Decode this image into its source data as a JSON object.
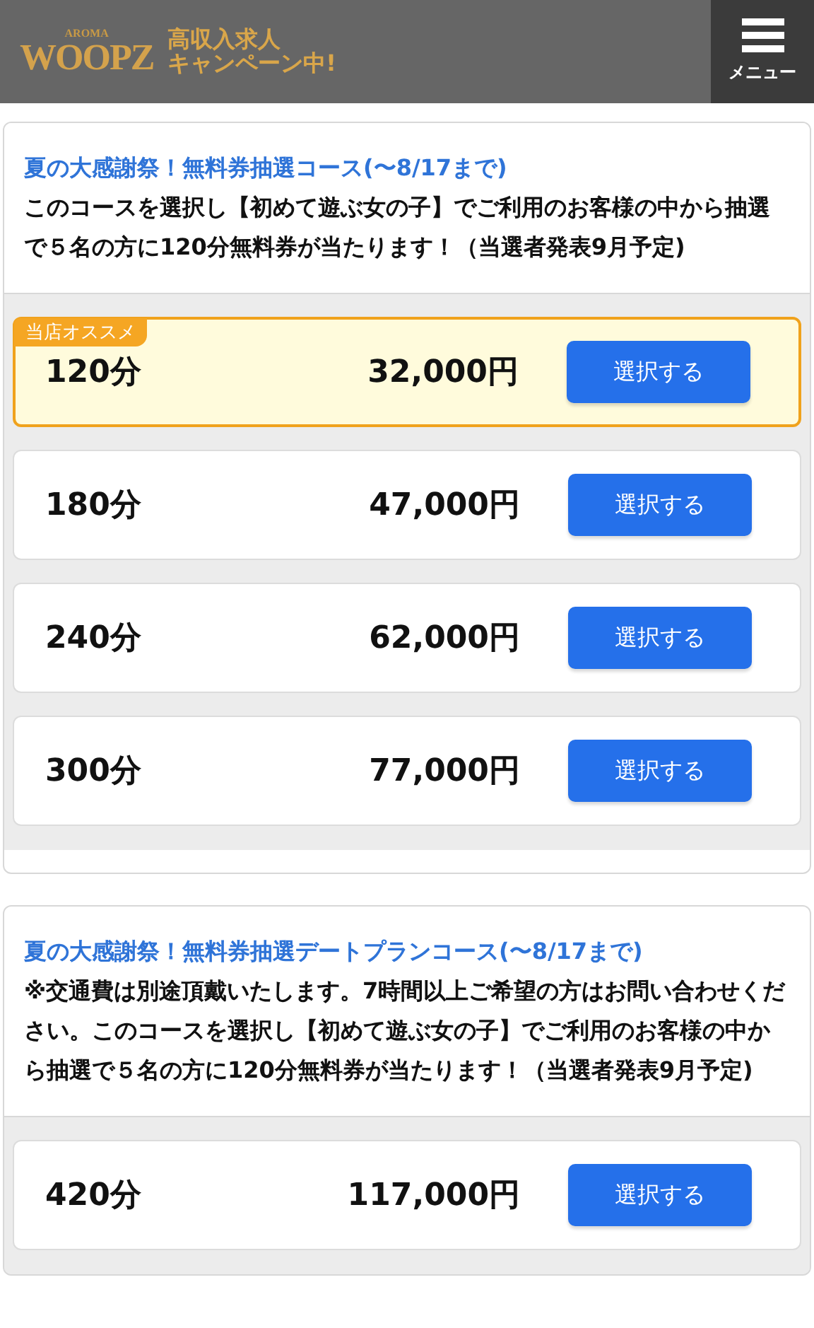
{
  "header": {
    "logo_top": "AROMA",
    "logo_main": "WOOPZ",
    "banner_lines": [
      "高収入求人",
      "キャンペーン中!"
    ],
    "menu_label": "メニュー"
  },
  "sections": [
    {
      "title": "夏の大感謝祭！無料券抽選コース(〜8/17まで)",
      "description": "このコースを選択し【初めて遊ぶ女の子】でご利用のお客様の中から抽選で５名の方に120分無料券が当たります！（当選者発表9月予定)",
      "plans": [
        {
          "duration": "120分",
          "price": "32,000円",
          "button": "選択する",
          "recommended": true,
          "badge": "当店オススメ"
        },
        {
          "duration": "180分",
          "price": "47,000円",
          "button": "選択する",
          "recommended": false
        },
        {
          "duration": "240分",
          "price": "62,000円",
          "button": "選択する",
          "recommended": false
        },
        {
          "duration": "300分",
          "price": "77,000円",
          "button": "選択する",
          "recommended": false
        }
      ]
    },
    {
      "title": "夏の大感謝祭！無料券抽選デートプランコース(〜8/17まで)",
      "description": "※交通費は別途頂戴いたします。7時間以上ご希望の方はお問い合わせください。このコースを選択し【初めて遊ぶ女の子】でご利用のお客様の中から抽選で５名の方に120分無料券が当たります！（当選者発表9月予定)",
      "plans": [
        {
          "duration": "420分",
          "price": "117,000円",
          "button": "選択する",
          "recommended": false
        }
      ]
    }
  ]
}
